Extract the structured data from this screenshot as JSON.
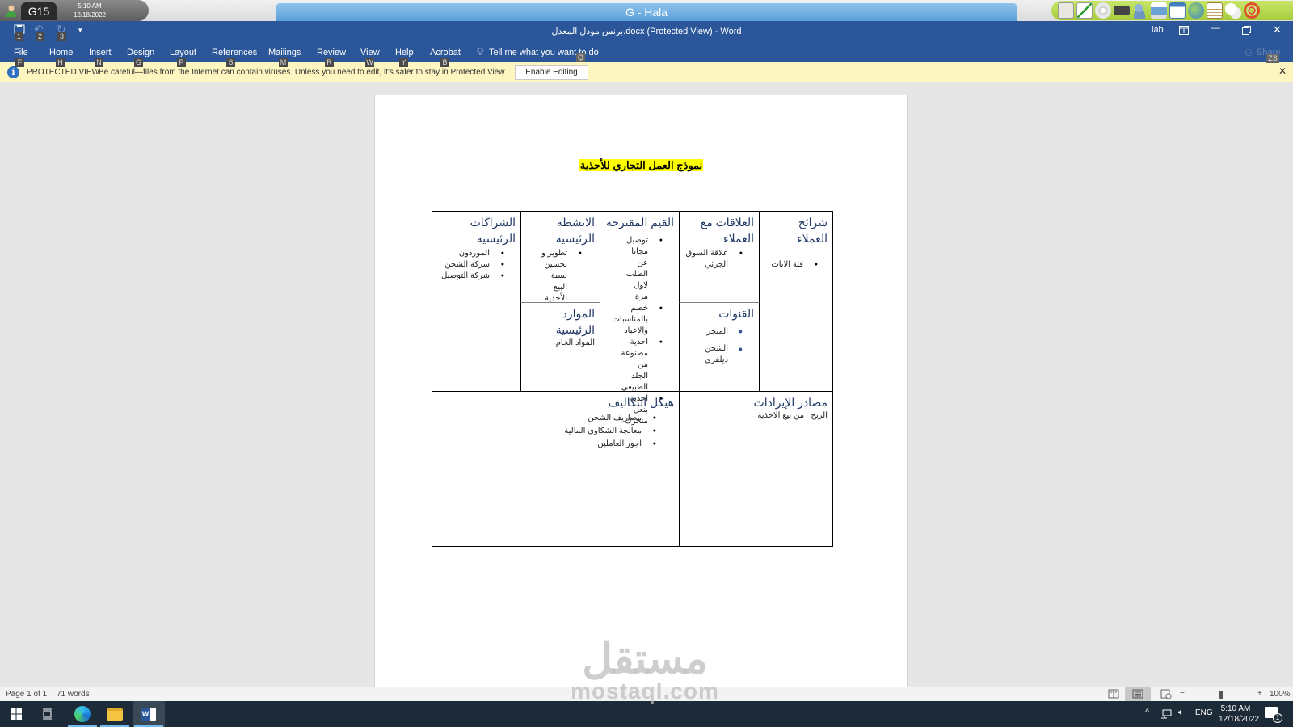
{
  "remote_bar": {
    "session": "G15",
    "time": "5:10 AM",
    "date": "12/18/2022",
    "window_title": "G - Hala",
    "tools": [
      "cabinet-icon",
      "chart-icon",
      "disc-icon",
      "scanner-icon",
      "users-icon",
      "printer-icon",
      "window-icon",
      "globe-icon",
      "notebook-icon",
      "chat-icon",
      "lifebuoy-icon"
    ]
  },
  "titlebar": {
    "quick_access_keys": [
      "1",
      "2",
      "3"
    ],
    "document_title": "برنس مودل المعدل.docx (Protected View)  -  Word",
    "user": "lab"
  },
  "ribbon": {
    "tabs": [
      {
        "label": "File",
        "key": "F"
      },
      {
        "label": "Home",
        "key": "H"
      },
      {
        "label": "Insert",
        "key": "N"
      },
      {
        "label": "Design",
        "key": "G"
      },
      {
        "label": "Layout",
        "key": "P"
      },
      {
        "label": "References",
        "key": "S"
      },
      {
        "label": "Mailings",
        "key": "M"
      },
      {
        "label": "Review",
        "key": "R"
      },
      {
        "label": "View",
        "key": "W"
      },
      {
        "label": "Help",
        "key": "Y"
      },
      {
        "label": "Acrobat",
        "key": "B"
      }
    ],
    "tell_me": "Tell me what you want to do",
    "tell_me_key": "Q",
    "share": "Share",
    "share_key": "ZS"
  },
  "protected_view": {
    "label": "PROTECTED VIEW",
    "message": "Be careful—files from the Internet can contain viruses. Unless you need to edit, it's safer to stay in Protected View.",
    "button": "Enable Editing"
  },
  "document": {
    "title": "نموذج العمل التجاري للأحذية",
    "canvas": {
      "customer_segments": {
        "heading": "شرائح العملاء",
        "items": [
          "فئة الاناث"
        ]
      },
      "customer_relationships": {
        "heading": "العلاقات مع العملاء",
        "items": [
          "علاقة السوق الجزئي"
        ]
      },
      "channels": {
        "heading": "القنوات",
        "items": [
          "المتجر",
          "الشحن ديلفري"
        ]
      },
      "value_propositions": {
        "heading": "القيم المقترحة",
        "items": [
          "توصيل مجانا عن الطلب لاول مرة",
          "خصم بالمناسبات والاعياد",
          "احذية مصنوعة من الجلد الطبيعي",
          "احذية بنعل متحرك"
        ]
      },
      "key_activities": {
        "heading": "الانشطة الرئيسية",
        "items": [
          "تطوير و تحسين نسبة البيع الأحذية"
        ]
      },
      "key_resources": {
        "heading": "الموارد الرئيسية",
        "text": "المواد الخام"
      },
      "key_partners": {
        "heading": "الشراكات الرئيسية",
        "items": [
          "الموردون",
          "شركة الشحن",
          "شركة التوصيل"
        ]
      },
      "revenue_streams": {
        "heading": "مصادر الإيرادات",
        "text": "الربح   من بيع الاحذية"
      },
      "cost_structure": {
        "heading": "هيكل التكاليف",
        "items": [
          "مصاريف الشحن",
          "معالجة الشكاوي المالية",
          "اجور العاملين"
        ]
      }
    }
  },
  "watermark": {
    "arabic": "مستقل",
    "latin": "mostaql.com"
  },
  "statusbar": {
    "page": "Page 1 of 1",
    "words": "71 words",
    "zoom": "100%",
    "zoom_minus": "−",
    "zoom_plus": "+"
  },
  "taskbar": {
    "lang": "ENG",
    "time": "5:10 AM",
    "date": "12/18/2022",
    "notifications": "1"
  }
}
